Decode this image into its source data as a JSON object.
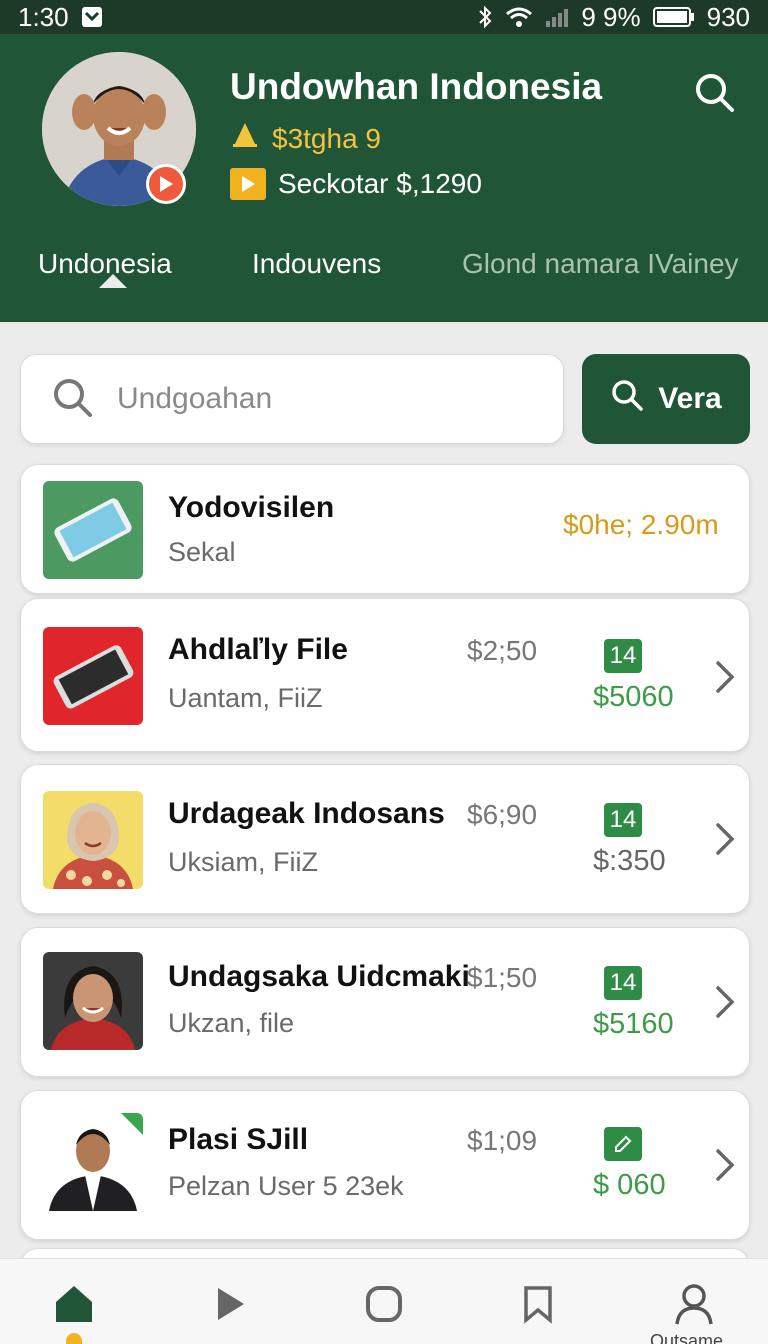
{
  "status_bar": {
    "time": "1:30",
    "battery_text": "9 9%",
    "clock_right": "930"
  },
  "header": {
    "title": "Undowhan Indonesia",
    "subtitle": "$3tgha 9",
    "stat": "Seckotar $,1290"
  },
  "tabs": [
    {
      "label": "Undonesia",
      "active": true
    },
    {
      "label": "Indouvens",
      "active": false
    },
    {
      "label": "Glond namara IVainey",
      "active": false
    }
  ],
  "search": {
    "placeholder": "Undgoahan",
    "button_label": "Vera"
  },
  "items": [
    {
      "name": "Yodovisilen",
      "sub": "Sekal",
      "price": "$0he; 2.90m"
    },
    {
      "name": "Ahdlaľly File",
      "sub": "Uantam, FiiZ",
      "price": "$2;50",
      "badge": "14",
      "amount": "$5060"
    },
    {
      "name": "Urdageak Indosans",
      "sub": "Uksiam, FiiZ",
      "price": "$6;90",
      "badge": "14",
      "amount": "$:350"
    },
    {
      "name": "Undagsaka Uidcmaki",
      "sub": "Ukzan, file",
      "price": "$1;50",
      "badge": "14",
      "amount": "$5160"
    },
    {
      "name": "Plasi SJill",
      "sub": "Pelzan User 5 23ek",
      "price": "$1;09",
      "amount": "$ 060"
    }
  ],
  "colors": {
    "header_green": "#215537",
    "accent_green": "#3e9b47",
    "gold": "#f5c33b",
    "price_gold": "#d99a1a"
  },
  "nav": {
    "items": [
      "home-icon",
      "play-icon",
      "circle-icon",
      "bookmark-icon",
      "user-icon"
    ],
    "profile_label": "Outsame"
  }
}
